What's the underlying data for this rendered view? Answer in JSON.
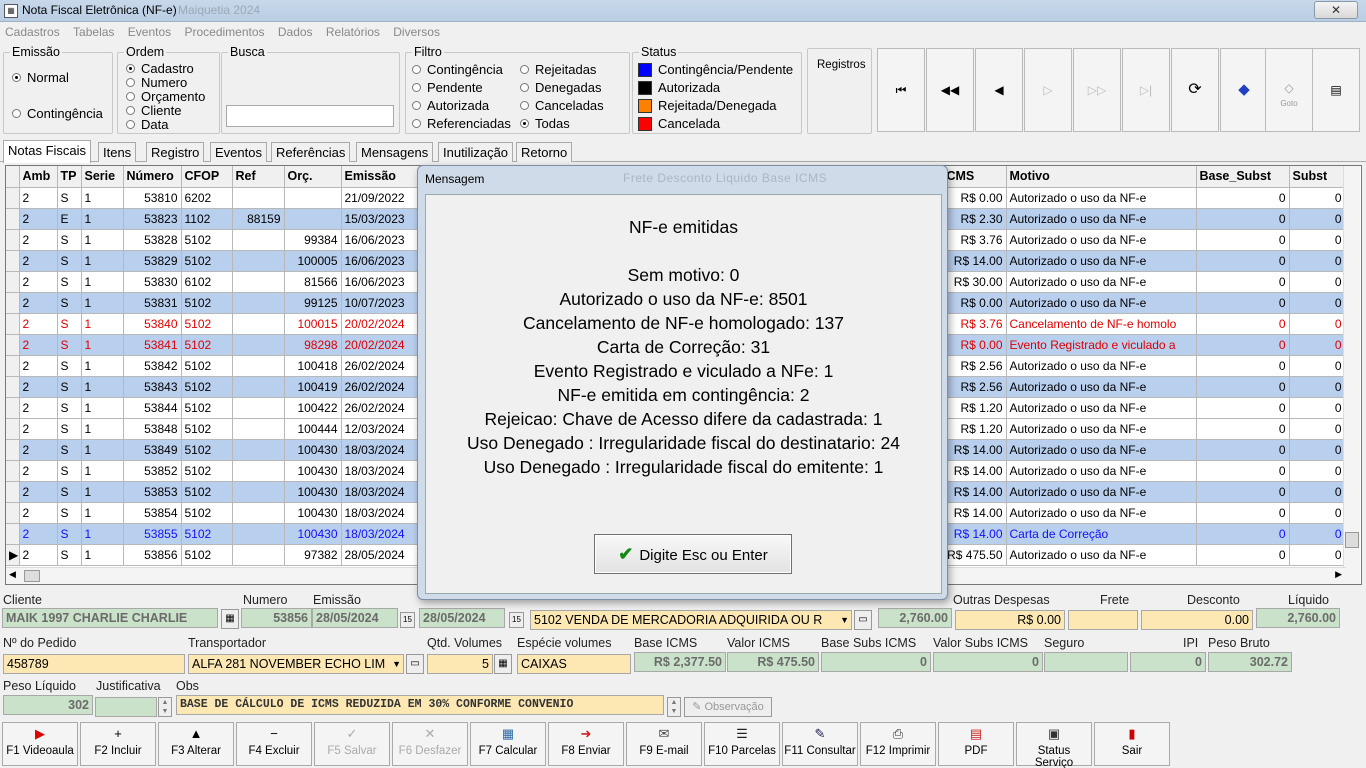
{
  "window": {
    "title": "Nota Fiscal Eletrônica (NF-e)",
    "title_suffix": "Maiquetia 2024",
    "close": "✕"
  },
  "menu": [
    "Cadastros",
    "Tabelas",
    "Eventos",
    "Procedimentos",
    "Dados",
    "Relatórios",
    "Diversos"
  ],
  "emissao": {
    "title": "Emissão",
    "normal": "Normal",
    "contingencia": "Contingência",
    "selected": "Normal"
  },
  "ordem": {
    "title": "Ordem",
    "options": [
      "Cadastro",
      "Numero",
      "Orçamento",
      "Cliente",
      "Data"
    ],
    "selected": "Cadastro"
  },
  "busca": {
    "title": "Busca",
    "value": ""
  },
  "filtro": {
    "title": "Filtro",
    "col1": [
      "Contingência",
      "Pendente",
      "Autorizada",
      "Referenciadas"
    ],
    "col2": [
      "Rejeitadas",
      "Denegadas",
      "Canceladas",
      "Todas"
    ],
    "selected": "Todas"
  },
  "status": {
    "title": "Status",
    "items": [
      {
        "label": "Contingência/Pendente",
        "color": "#0000ff"
      },
      {
        "label": "Autorizada",
        "color": "#000000"
      },
      {
        "label": "Rejeitada/Denegada",
        "color": "#ff8000"
      },
      {
        "label": "Cancelada",
        "color": "#ff0000"
      }
    ]
  },
  "registros": {
    "label": "Registros"
  },
  "nav": {
    "first": "⏮",
    "prev_page": "◀◀",
    "prev": "◀",
    "next": "▷",
    "next_page": "▷▷",
    "last": "▷|",
    "refresh": "⟳",
    "goto_label": "Goto",
    "report": "▤"
  },
  "tabs": [
    "Notas Fiscais",
    "Itens",
    "Registro",
    "Eventos",
    "Referências",
    "Mensagens",
    "Inutilização",
    "Retorno"
  ],
  "grid": {
    "headers_left": [
      "Amb",
      "TP",
      "Serie",
      "Número",
      "CFOP",
      "Ref",
      "Orç.",
      "Emissão"
    ],
    "headers_right": [
      "ICMS",
      "Motivo",
      "Base_Subst",
      "Subst"
    ],
    "rows": [
      {
        "c": [
          "2",
          "S",
          "1",
          "53810",
          "6202",
          "",
          "",
          "21/09/2022"
        ],
        "icms": "R$ 0.00",
        "motivo": "Autorizado o uso da NF-e",
        "bs": "0",
        "st": "0",
        "style": ""
      },
      {
        "c": [
          "2",
          "E",
          "1",
          "53823",
          "1102",
          "88159",
          "",
          "15/03/2023"
        ],
        "icms": "R$ 2.30",
        "motivo": "Autorizado o uso da NF-e",
        "bs": "0",
        "st": "0",
        "style": "alt"
      },
      {
        "c": [
          "2",
          "S",
          "1",
          "53828",
          "5102",
          "",
          "99384",
          "16/06/2023"
        ],
        "icms": "R$ 3.76",
        "motivo": "Autorizado o uso da NF-e",
        "bs": "0",
        "st": "0",
        "style": ""
      },
      {
        "c": [
          "2",
          "S",
          "1",
          "53829",
          "5102",
          "",
          "100005",
          "16/06/2023"
        ],
        "icms": "R$ 14.00",
        "motivo": "Autorizado o uso da NF-e",
        "bs": "0",
        "st": "0",
        "style": "alt"
      },
      {
        "c": [
          "2",
          "S",
          "1",
          "53830",
          "6102",
          "",
          "81566",
          "16/06/2023"
        ],
        "icms": "R$ 30.00",
        "motivo": "Autorizado o uso da NF-e",
        "bs": "0",
        "st": "0",
        "style": ""
      },
      {
        "c": [
          "2",
          "S",
          "1",
          "53831",
          "5102",
          "",
          "99125",
          "10/07/2023"
        ],
        "icms": "R$ 0.00",
        "motivo": "Autorizado o uso da NF-e",
        "bs": "0",
        "st": "0",
        "style": "alt"
      },
      {
        "c": [
          "2",
          "S",
          "1",
          "53840",
          "5102",
          "",
          "100015",
          "20/02/2024"
        ],
        "icms": "R$ 3.76",
        "motivo": "Cancelamento de NF-e homolo",
        "bs": "0",
        "st": "0",
        "style": "red"
      },
      {
        "c": [
          "2",
          "S",
          "1",
          "53841",
          "5102",
          "",
          "98298",
          "20/02/2024"
        ],
        "icms": "R$ 0.00",
        "motivo": "Evento Registrado e viculado a",
        "bs": "0",
        "st": "0",
        "style": "alt red"
      },
      {
        "c": [
          "2",
          "S",
          "1",
          "53842",
          "5102",
          "",
          "100418",
          "26/02/2024"
        ],
        "icms": "R$ 2.56",
        "motivo": "Autorizado o uso da NF-e",
        "bs": "0",
        "st": "0",
        "style": ""
      },
      {
        "c": [
          "2",
          "S",
          "1",
          "53843",
          "5102",
          "",
          "100419",
          "26/02/2024"
        ],
        "icms": "R$ 2.56",
        "motivo": "Autorizado o uso da NF-e",
        "bs": "0",
        "st": "0",
        "style": "alt"
      },
      {
        "c": [
          "2",
          "S",
          "1",
          "53844",
          "5102",
          "",
          "100422",
          "26/02/2024"
        ],
        "icms": "R$ 1.20",
        "motivo": "Autorizado o uso da NF-e",
        "bs": "0",
        "st": "0",
        "style": ""
      },
      {
        "c": [
          "2",
          "S",
          "1",
          "53848",
          "5102",
          "",
          "100444",
          "12/03/2024"
        ],
        "icms": "R$ 1.20",
        "motivo": "Autorizado o uso da NF-e",
        "bs": "0",
        "st": "0",
        "style": ""
      },
      {
        "c": [
          "2",
          "S",
          "1",
          "53849",
          "5102",
          "",
          "100430",
          "18/03/2024"
        ],
        "icms": "R$ 14.00",
        "motivo": "Autorizado o uso da NF-e",
        "bs": "0",
        "st": "0",
        "style": "alt"
      },
      {
        "c": [
          "2",
          "S",
          "1",
          "53852",
          "5102",
          "",
          "100430",
          "18/03/2024"
        ],
        "icms": "R$ 14.00",
        "motivo": "Autorizado o uso da NF-e",
        "bs": "0",
        "st": "0",
        "style": ""
      },
      {
        "c": [
          "2",
          "S",
          "1",
          "53853",
          "5102",
          "",
          "100430",
          "18/03/2024"
        ],
        "icms": "R$ 14.00",
        "motivo": "Autorizado o uso da NF-e",
        "bs": "0",
        "st": "0",
        "style": "alt"
      },
      {
        "c": [
          "2",
          "S",
          "1",
          "53854",
          "5102",
          "",
          "100430",
          "18/03/2024"
        ],
        "icms": "R$ 14.00",
        "motivo": "Autorizado o uso da NF-e",
        "bs": "0",
        "st": "0",
        "style": ""
      },
      {
        "c": [
          "2",
          "S",
          "1",
          "53855",
          "5102",
          "",
          "100430",
          "18/03/2024"
        ],
        "icms": "R$ 14.00",
        "motivo": "Carta de Correção",
        "bs": "0",
        "st": "0",
        "style": "alt blue"
      },
      {
        "c": [
          "2",
          "S",
          "1",
          "53856",
          "5102",
          "",
          "97382",
          "28/05/2024"
        ],
        "icms": "R$ 475.50",
        "motivo": "Autorizado o uso da NF-e",
        "bs": "0",
        "st": "0",
        "style": ""
      }
    ]
  },
  "form": {
    "cliente_label": "Cliente",
    "cliente": "MAIK 1997 CHARLIE CHARLIE",
    "numero_label": "Numero",
    "numero": "53856",
    "emissao_label": "Emissão",
    "emissao": "28/05/2024",
    "saida": "28/05/2024",
    "natureza": "5102 VENDA DE MERCADORIA ADQUIRIDA OU R",
    "valor": "2,760.00",
    "outras_label": "Outras Despesas",
    "outras": "R$ 0.00",
    "frete_label": "Frete",
    "frete": "",
    "desconto_label": "Desconto",
    "desconto": "0.00",
    "liquido_label": "Líquido",
    "liquido": "2,760.00",
    "pedido_label": "Nº do Pedido",
    "pedido": "458789",
    "transp_label": "Transportador",
    "transp": "ALFA 281 NOVEMBER ECHO LIM",
    "qtd_label": "Qtd. Volumes",
    "qtd": "5",
    "especie_label": "Espécie volumes",
    "especie": "CAIXAS",
    "base_icms_label": "Base ICMS",
    "base_icms": "R$ 2,377.50",
    "valor_icms_label": "Valor ICMS",
    "valor_icms": "R$ 475.50",
    "base_subs_label": "Base Subs ICMS",
    "base_subs": "0",
    "valor_subs_label": "Valor Subs ICMS",
    "valor_subs": "0",
    "seguro_label": "Seguro",
    "seguro": "",
    "ipi_label": "IPI",
    "ipi": "0",
    "peso_bruto_label": "Peso Bruto",
    "peso_bruto": "302.72",
    "peso_liq_label": "Peso Líquido",
    "peso_liq": "302",
    "justif_label": "Justificativa",
    "justif": "",
    "obs_label": "Obs",
    "obs": "BASE DE CÁLCULO DE ICMS REDUZIDA EM  30%  CONFORME  CONVENIO",
    "observacao_btn": "Observação"
  },
  "fkeys": [
    {
      "label": "F1 Videoaula",
      "icon": "▶",
      "color": "#e00000",
      "enabled": true
    },
    {
      "label": "F2 Incluir",
      "icon": "+",
      "color": "#000",
      "enabled": true
    },
    {
      "label": "F3 Alterar",
      "icon": "▲",
      "color": "#000",
      "enabled": true
    },
    {
      "label": "F4 Excluir",
      "icon": "−",
      "color": "#000",
      "enabled": true
    },
    {
      "label": "F5 Salvar",
      "icon": "✓",
      "color": "#aaa",
      "enabled": false
    },
    {
      "label": "F6 Desfazer",
      "icon": "✕",
      "color": "#aaa",
      "enabled": false
    },
    {
      "label": "F7 Calcular",
      "icon": "▦",
      "color": "#2a6aa8",
      "enabled": true
    },
    {
      "label": "F8 Enviar",
      "icon": "➜",
      "color": "#d02020",
      "enabled": true
    },
    {
      "label": "F9 E-mail",
      "icon": "✉",
      "color": "#444",
      "enabled": true
    },
    {
      "label": "F10 Parcelas",
      "icon": "☰",
      "color": "#222",
      "enabled": true
    },
    {
      "label": "F11 Consultar",
      "icon": "✎",
      "color": "#225",
      "enabled": true
    },
    {
      "label": "F12 Imprimir",
      "icon": "⎙",
      "color": "#333",
      "enabled": true
    },
    {
      "label": "PDF",
      "icon": "▤",
      "color": "#d02020",
      "enabled": true
    },
    {
      "label": "Status Serviço",
      "icon": "▣",
      "color": "#333",
      "enabled": true
    },
    {
      "label": "Sair",
      "icon": "▮",
      "color": "#c00",
      "enabled": true
    }
  ],
  "modal": {
    "title": "Mensagem",
    "title_blur": "Frete    Desconto   Liquido    Base ICMS",
    "heading": "NF-e emitidas",
    "lines": [
      "Sem motivo: 0",
      "Autorizado o uso da NF-e: 8501",
      "Cancelamento de NF-e homologado: 137",
      "Carta de Correção: 31",
      "Evento Registrado e viculado a NFe: 1",
      "NF-e emitida em contingência: 2",
      "Rejeicao: Chave de Acesso difere da cadastrada: 1",
      "Uso Denegado : Irregularidade fiscal do destinatario: 24",
      "Uso Denegado : Irregularidade fiscal do emitente: 1"
    ],
    "button": "Digite Esc ou Enter"
  }
}
